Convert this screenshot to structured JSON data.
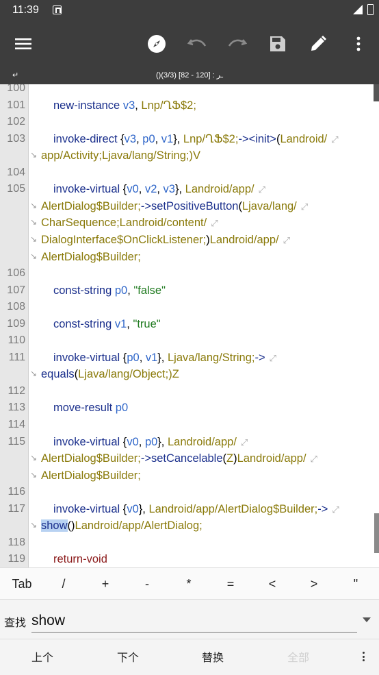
{
  "status_bar": {
    "time": "11:39"
  },
  "info_bar": {
    "wrap_mark": "↵",
    "position_text": "()ـر : [120 - 82]  (3/3)"
  },
  "editor": {
    "lines": [
      {
        "num": "100"
      },
      {
        "num": "101",
        "tokens": [
          {
            "t": "new-instance",
            "c": "kw"
          },
          {
            "t": " v3",
            "c": "reg"
          },
          {
            "t": ",",
            "c": "p"
          },
          {
            "t": " Lnp/ՂՖ$2;",
            "c": "typ"
          }
        ]
      },
      {
        "num": "102"
      },
      {
        "num": "103",
        "tokens": [
          {
            "t": "invoke-direct",
            "c": "kw"
          },
          {
            "t": " {",
            "c": "p"
          },
          {
            "t": "v3",
            "c": "reg"
          },
          {
            "t": ", ",
            "c": "p"
          },
          {
            "t": "p0",
            "c": "reg"
          },
          {
            "t": ", ",
            "c": "p"
          },
          {
            "t": "v1",
            "c": "reg"
          },
          {
            "t": "},",
            "c": "p"
          },
          {
            "t": " Lnp/ՂՖ$2;",
            "c": "typ"
          },
          {
            "t": "-><init>",
            "c": "kw"
          },
          {
            "t": "(",
            "c": "p"
          },
          {
            "t": "Landroid/",
            "c": "typ"
          }
        ],
        "wrap": true
      },
      {
        "num": "",
        "cont": true,
        "tokens": [
          {
            "t": "app/Activity;Ljava/lang/String;",
            "c": "typ"
          },
          {
            "t": ")V",
            "c": "typ"
          }
        ]
      },
      {
        "num": "104"
      },
      {
        "num": "105",
        "tokens": [
          {
            "t": "invoke-virtual",
            "c": "kw"
          },
          {
            "t": " {",
            "c": "p"
          },
          {
            "t": "v0",
            "c": "reg"
          },
          {
            "t": ", ",
            "c": "p"
          },
          {
            "t": "v2",
            "c": "reg"
          },
          {
            "t": ", ",
            "c": "p"
          },
          {
            "t": "v3",
            "c": "reg"
          },
          {
            "t": "},",
            "c": "p"
          },
          {
            "t": " Landroid/app/",
            "c": "typ"
          }
        ],
        "wrap": true
      },
      {
        "num": "",
        "cont": true,
        "tokens": [
          {
            "t": "AlertDialog$Builder;",
            "c": "typ"
          },
          {
            "t": "->setPositiveButton",
            "c": "kw"
          },
          {
            "t": "(",
            "c": "p"
          },
          {
            "t": "Ljava/lang/",
            "c": "typ"
          }
        ],
        "wrap": true
      },
      {
        "num": "",
        "cont": true,
        "tokens": [
          {
            "t": "CharSequence;Landroid/content/",
            "c": "typ"
          }
        ],
        "wrap": true
      },
      {
        "num": "",
        "cont": true,
        "tokens": [
          {
            "t": "DialogInterface$OnClickListener;",
            "c": "typ"
          },
          {
            "t": ")",
            "c": "p"
          },
          {
            "t": "Landroid/app/",
            "c": "typ"
          }
        ],
        "wrap": true
      },
      {
        "num": "",
        "cont": true,
        "tokens": [
          {
            "t": "AlertDialog$Builder;",
            "c": "typ"
          }
        ]
      },
      {
        "num": "106"
      },
      {
        "num": "107",
        "tokens": [
          {
            "t": "const-string",
            "c": "kw"
          },
          {
            "t": " p0",
            "c": "reg"
          },
          {
            "t": ",",
            "c": "p"
          },
          {
            "t": " \"false\"",
            "c": "str"
          }
        ]
      },
      {
        "num": "108"
      },
      {
        "num": "109",
        "tokens": [
          {
            "t": "const-string",
            "c": "kw"
          },
          {
            "t": " v1",
            "c": "reg"
          },
          {
            "t": ",",
            "c": "p"
          },
          {
            "t": " \"true\"",
            "c": "str"
          }
        ]
      },
      {
        "num": "110"
      },
      {
        "num": "111",
        "tokens": [
          {
            "t": "invoke-virtual",
            "c": "kw"
          },
          {
            "t": " {",
            "c": "p"
          },
          {
            "t": "p0",
            "c": "reg"
          },
          {
            "t": ", ",
            "c": "p"
          },
          {
            "t": "v1",
            "c": "reg"
          },
          {
            "t": "},",
            "c": "p"
          },
          {
            "t": " Ljava/lang/String;",
            "c": "typ"
          },
          {
            "t": "->",
            "c": "kw"
          }
        ],
        "wrap": true
      },
      {
        "num": "",
        "cont": true,
        "tokens": [
          {
            "t": "equals",
            "c": "kw"
          },
          {
            "t": "(",
            "c": "p"
          },
          {
            "t": "Ljava/lang/Object;",
            "c": "typ"
          },
          {
            "t": ")Z",
            "c": "typ"
          }
        ]
      },
      {
        "num": "112"
      },
      {
        "num": "113",
        "tokens": [
          {
            "t": "move-result",
            "c": "kw"
          },
          {
            "t": " p0",
            "c": "reg"
          }
        ]
      },
      {
        "num": "114"
      },
      {
        "num": "115",
        "tokens": [
          {
            "t": "invoke-virtual",
            "c": "kw"
          },
          {
            "t": " {",
            "c": "p"
          },
          {
            "t": "v0",
            "c": "reg"
          },
          {
            "t": ", ",
            "c": "p"
          },
          {
            "t": "p0",
            "c": "reg"
          },
          {
            "t": "},",
            "c": "p"
          },
          {
            "t": " Landroid/app/",
            "c": "typ"
          }
        ],
        "wrap": true
      },
      {
        "num": "",
        "cont": true,
        "tokens": [
          {
            "t": "AlertDialog$Builder;",
            "c": "typ"
          },
          {
            "t": "->setCancelable",
            "c": "kw"
          },
          {
            "t": "(",
            "c": "p"
          },
          {
            "t": "Z",
            "c": "typ"
          },
          {
            "t": ")",
            "c": "p"
          },
          {
            "t": "Landroid/app/",
            "c": "typ"
          }
        ],
        "wrap": true
      },
      {
        "num": "",
        "cont": true,
        "tokens": [
          {
            "t": "AlertDialog$Builder;",
            "c": "typ"
          }
        ]
      },
      {
        "num": "116"
      },
      {
        "num": "117",
        "tokens": [
          {
            "t": "invoke-virtual",
            "c": "kw"
          },
          {
            "t": " {",
            "c": "p"
          },
          {
            "t": "v0",
            "c": "reg"
          },
          {
            "t": "},",
            "c": "p"
          },
          {
            "t": " Landroid/app/AlertDialog$Builder;",
            "c": "typ"
          },
          {
            "t": "->",
            "c": "kw"
          }
        ],
        "wrap": true
      },
      {
        "num": "",
        "cont": true,
        "tokens": [
          {
            "t": "show",
            "c": "kw",
            "hl": true
          },
          {
            "t": "()",
            "c": "p"
          },
          {
            "t": "Landroid/app/AlertDialog;",
            "c": "typ"
          }
        ]
      },
      {
        "num": "118"
      },
      {
        "num": "119",
        "tokens": [
          {
            "t": "return-void",
            "c": "ret"
          }
        ]
      }
    ]
  },
  "symbols": [
    "Tab",
    "/",
    "+",
    "-",
    "*",
    "=",
    "<",
    ">",
    "\""
  ],
  "find": {
    "label": "查找",
    "value": "show"
  },
  "actions": {
    "prev": "上个",
    "next": "下个",
    "replace": "替换",
    "all": "全部"
  }
}
